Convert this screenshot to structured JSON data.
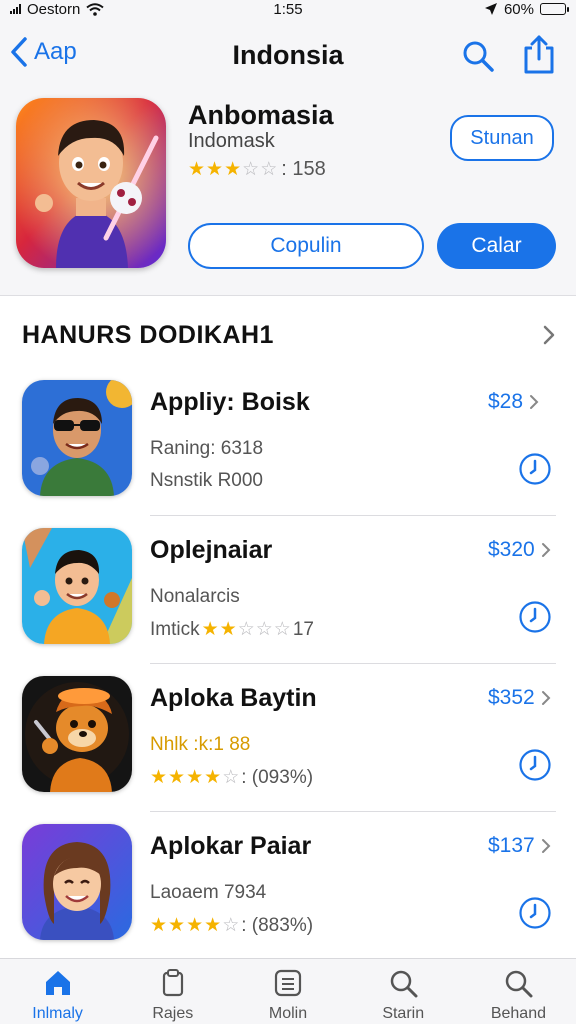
{
  "status_bar": {
    "carrier": "Oestorn",
    "time": "1:55",
    "battery": "60%",
    "battery_level": 0.6,
    "battery_color": "#f0c419"
  },
  "nav": {
    "back_label": "Aap",
    "title": "Indonsia",
    "search_icon": "search-icon",
    "share_icon": "share-icon"
  },
  "hero": {
    "name": "Anbomasia",
    "subtitle": "Indomask",
    "rating_count": ": 158",
    "stars_filled": 3,
    "action_label": "Stunan",
    "secondary_button": "Copulin",
    "primary_button": "Calar"
  },
  "section": {
    "title": "HANURS DODIKAH1"
  },
  "apps": [
    {
      "name": "Appliy: Boisk",
      "line1": "Raning: 6318",
      "line2": "Nsnstik R000",
      "price": "$28",
      "stars": 0,
      "icon": "sunglasses-character-icon"
    },
    {
      "name": "Oplejnaiar",
      "line1": "Nonalarcis",
      "line2": "Imtick",
      "line2_suffix": "17",
      "price": "$320",
      "stars": 2,
      "icon": "kid-character-icon"
    },
    {
      "name": "Aploka Baytin",
      "line1": "Nhlk :k:1 88",
      "line2": ": (093%)",
      "price": "$352",
      "stars": 4,
      "icon": "fox-character-icon"
    },
    {
      "name": "Aplokar Paiar",
      "line1": "Laoaem 7934",
      "line2": ": (883%)",
      "price": "$137",
      "stars": 4,
      "icon": "girl-character-icon"
    }
  ],
  "tabs": [
    {
      "label": "Inlmaly",
      "icon": "home-icon",
      "active": true
    },
    {
      "label": "Rajes",
      "icon": "games-icon",
      "active": false
    },
    {
      "label": "Molin",
      "icon": "apps-icon",
      "active": false
    },
    {
      "label": "Starin",
      "icon": "search-icon",
      "active": false
    },
    {
      "label": "Behand",
      "icon": "search-icon",
      "active": false
    }
  ],
  "colors": {
    "accent": "#1a73e8",
    "star": "#f5b300"
  }
}
